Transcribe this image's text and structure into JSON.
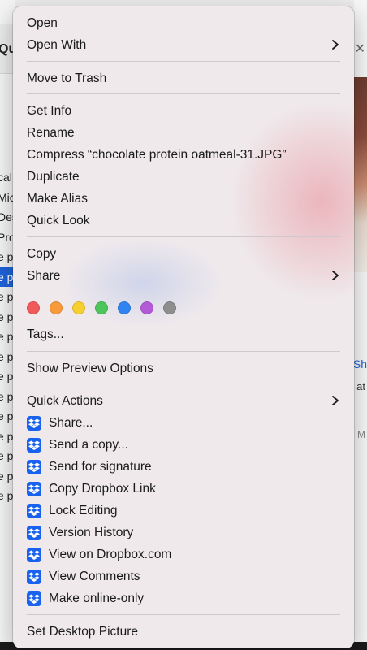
{
  "background": {
    "window_title_fragment": "Qu",
    "left_rows": [
      "cal",
      "Mic",
      "Des",
      "Pro",
      "e p",
      "e p",
      "e p",
      "e p",
      "e p",
      "e p",
      "e p",
      "e p",
      "e p",
      "e p",
      "e p",
      "e p",
      "e p"
    ],
    "selected_row_index": 5,
    "right_link_fragment": "Sh",
    "right_text_fragment": "at",
    "right_m_fragment": "M"
  },
  "menu": {
    "open": "Open",
    "open_with": "Open With",
    "move_to_trash": "Move to Trash",
    "get_info": "Get Info",
    "rename": "Rename",
    "compress": "Compress “chocolate protein oatmeal-31.JPG”",
    "duplicate": "Duplicate",
    "make_alias": "Make Alias",
    "quick_look": "Quick Look",
    "copy": "Copy",
    "share": "Share",
    "tags": "Tags...",
    "show_preview_options": "Show Preview Options",
    "quick_actions": "Quick Actions",
    "dropbox_items": [
      "Share...",
      "Send a copy...",
      "Send for signature",
      "Copy Dropbox Link",
      "Lock Editing",
      "Version History",
      "View on Dropbox.com",
      "View Comments",
      "Make online-only"
    ],
    "set_desktop_picture": "Set Desktop Picture"
  },
  "tag_colors": [
    {
      "name": "red",
      "color": "#f05a5a"
    },
    {
      "name": "orange",
      "color": "#f89a3a"
    },
    {
      "name": "yellow",
      "color": "#f7cf2e"
    },
    {
      "name": "green",
      "color": "#4cc55a"
    },
    {
      "name": "blue",
      "color": "#2f83f2"
    },
    {
      "name": "purple",
      "color": "#b35bd6"
    },
    {
      "name": "gray",
      "color": "#8e8e8e"
    }
  ],
  "icons": {
    "submenu": "chevron-right-icon",
    "dropbox": "dropbox-icon"
  },
  "colors": {
    "menu_background": "#efe9ec",
    "dropbox_blue": "#1962ef",
    "selection_blue": "#1f63d9"
  }
}
